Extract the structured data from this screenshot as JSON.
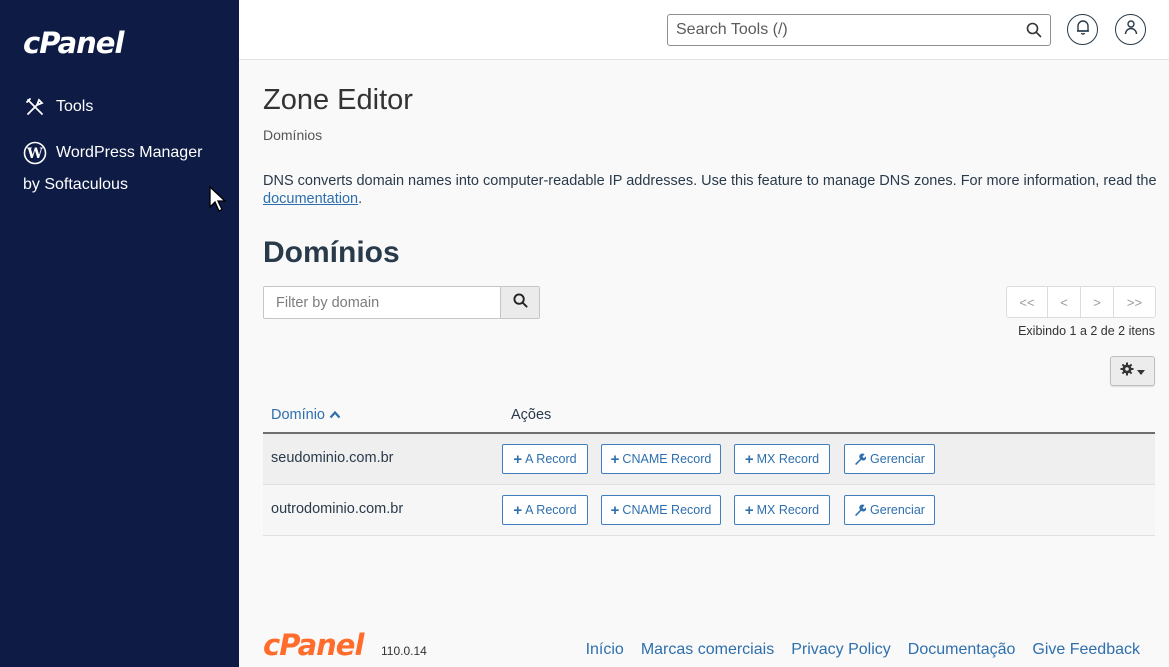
{
  "sidebar": {
    "logo": "cPanel",
    "items": [
      {
        "label": "Tools",
        "icon": "tools-icon"
      },
      {
        "label": "WordPress Manager",
        "sub": "by Softaculous",
        "icon": "wordpress-icon"
      }
    ]
  },
  "topbar": {
    "search_placeholder": "Search Tools (/)"
  },
  "page": {
    "title": "Zone Editor",
    "breadcrumb": "Domínios",
    "description_text": "DNS converts domain names into computer-readable IP addresses. Use this feature to manage DNS zones. For more information, read the ",
    "description_link": "documentation",
    "description_end": ".",
    "section_title": "Domínios"
  },
  "filter": {
    "placeholder": "Filter by domain"
  },
  "pager": {
    "first": "<<",
    "prev": "<",
    "next": ">",
    "last": ">>",
    "showing": "Exibindo 1 a 2 de 2 itens"
  },
  "table": {
    "col_domain": "Domínio",
    "col_actions": "Ações",
    "rows": [
      {
        "domain": "seudominio.com.br"
      },
      {
        "domain": "outrodominio.com.br"
      }
    ],
    "actions": {
      "a_record": "A Record",
      "cname_record": "CNAME Record",
      "mx_record": "MX Record",
      "manage": "Gerenciar"
    }
  },
  "footer": {
    "logo": "cPanel",
    "version": "110.0.14",
    "links": [
      "Início",
      "Marcas comerciais",
      "Privacy Policy",
      "Documentação",
      "Give Feedback"
    ]
  },
  "colors": {
    "sidebar_bg": "#0e1b44",
    "accent": "#2e6fae",
    "brand_orange": "#ff6c2c"
  }
}
